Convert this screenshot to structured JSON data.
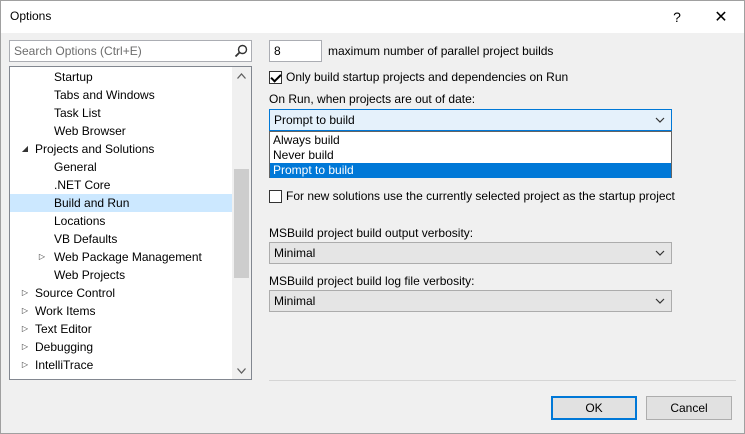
{
  "window": {
    "title": "Options",
    "help_glyph": "?",
    "close_glyph": "✕"
  },
  "search": {
    "placeholder": "Search Options (Ctrl+E)",
    "icon": "search-icon"
  },
  "tree": {
    "items": [
      {
        "label": "Startup",
        "level": 2,
        "expander": ""
      },
      {
        "label": "Tabs and Windows",
        "level": 2,
        "expander": ""
      },
      {
        "label": "Task List",
        "level": 2,
        "expander": ""
      },
      {
        "label": "Web Browser",
        "level": 2,
        "expander": ""
      },
      {
        "label": "Projects and Solutions",
        "level": 1,
        "expander": "expanded"
      },
      {
        "label": "General",
        "level": 2,
        "expander": ""
      },
      {
        "label": ".NET Core",
        "level": 2,
        "expander": ""
      },
      {
        "label": "Build and Run",
        "level": 2,
        "expander": "",
        "selected": true
      },
      {
        "label": "Locations",
        "level": 2,
        "expander": ""
      },
      {
        "label": "VB Defaults",
        "level": 2,
        "expander": ""
      },
      {
        "label": "Web Package Management",
        "level": 2,
        "expander": "collapsed"
      },
      {
        "label": "Web Projects",
        "level": 2,
        "expander": ""
      },
      {
        "label": "Source Control",
        "level": 1,
        "expander": "collapsed"
      },
      {
        "label": "Work Items",
        "level": 1,
        "expander": "collapsed"
      },
      {
        "label": "Text Editor",
        "level": 1,
        "expander": "collapsed"
      },
      {
        "label": "Debugging",
        "level": 1,
        "expander": "collapsed"
      },
      {
        "label": "IntelliTrace",
        "level": 1,
        "expander": "collapsed"
      }
    ]
  },
  "settings": {
    "parallel_builds_value": "8",
    "parallel_builds_label": "maximum number of parallel project builds",
    "only_startup_checked": true,
    "only_startup_label": "Only build startup projects and dependencies on Run",
    "on_run_label": "On Run, when projects are out of date:",
    "on_run_selected": "Prompt to build",
    "on_run_options": [
      "Always build",
      "Never build",
      "Prompt to build"
    ],
    "new_solutions_checked": false,
    "new_solutions_label": "For new solutions use the currently selected project as the startup project",
    "output_verbosity_label": "MSBuild project build output verbosity:",
    "output_verbosity_value": "Minimal",
    "log_verbosity_label": "MSBuild project build log file verbosity:",
    "log_verbosity_value": "Minimal"
  },
  "buttons": {
    "ok": "OK",
    "cancel": "Cancel"
  },
  "colors": {
    "accent": "#0078d7",
    "selection": "#cce8ff"
  }
}
